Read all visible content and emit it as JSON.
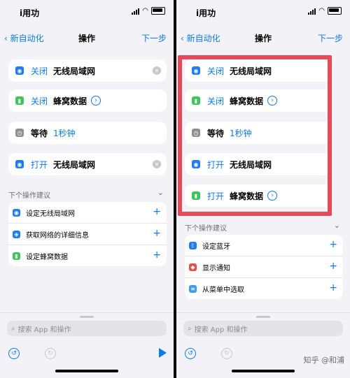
{
  "status": {
    "carrier": "i用功"
  },
  "nav": {
    "back": "新自动化",
    "title": "操作",
    "next": "下一步"
  },
  "left": {
    "actions": [
      {
        "keyword": "关闭",
        "text": "无线局域网",
        "icon": "wifi-icon",
        "color": "#1e7cf5"
      },
      {
        "keyword": "关闭",
        "text": "蜂窝数据",
        "icon": "cellular-icon",
        "color": "#39c759",
        "chevron": true
      },
      {
        "keyword": "等待",
        "text": "1秒钟",
        "icon": "clock-icon",
        "color": "#8e8e93"
      },
      {
        "keyword": "打开",
        "text": "无线局域网",
        "icon": "wifi-icon",
        "color": "#1e7cf5"
      }
    ],
    "suggestions_title": "下个操作建议",
    "suggestions": [
      {
        "label": "设定无线局域网",
        "icon": "wifi-icon"
      },
      {
        "label": "获取网络的详细信息",
        "icon": "network-icon"
      },
      {
        "label": "设定蜂窝数据",
        "icon": "cellular-icon"
      }
    ]
  },
  "right": {
    "actions": [
      {
        "keyword": "关闭",
        "text": "无线局域网",
        "icon": "wifi-icon"
      },
      {
        "keyword": "关闭",
        "text": "蜂窝数据",
        "icon": "cellular-icon",
        "chevron": true
      },
      {
        "keyword": "等待",
        "text": "1秒钟",
        "icon": "clock-icon"
      },
      {
        "keyword": "打开",
        "text": "无线局域网",
        "icon": "wifi-icon"
      },
      {
        "keyword": "打开",
        "text": "蜂窝数据",
        "icon": "cellular-icon",
        "chevron": true
      }
    ],
    "suggestions_title": "下个操作建议",
    "suggestions": [
      {
        "label": "设定蓝牙",
        "icon": "bluetooth-icon"
      },
      {
        "label": "显示通知",
        "icon": "notification-icon"
      },
      {
        "label": "从菜单中选取",
        "icon": "menu-icon"
      }
    ]
  },
  "search": {
    "placeholder": "搜索 App 和操作"
  },
  "watermark": "知乎 @和浦",
  "colors": {
    "accent": "#0a7aff",
    "highlight": "#e94859"
  }
}
